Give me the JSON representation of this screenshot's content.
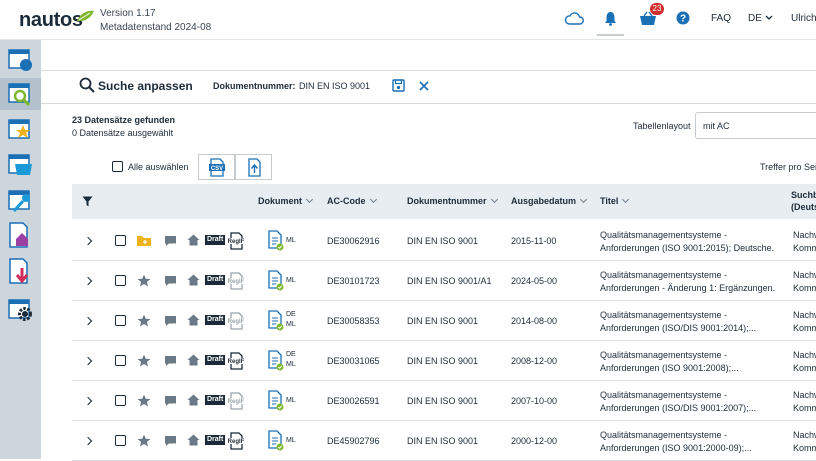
{
  "header": {
    "logo": "nautos",
    "version": "Version 1.17",
    "metadata": "Metadatenstand 2024-08",
    "basket_count": "23",
    "faq": "FAQ",
    "language": "DE",
    "user": "Ulrich"
  },
  "search": {
    "title": "Suche anpassen",
    "field_label": "Dokumentnummer:",
    "field_value": "DIN EN ISO 9001"
  },
  "results": {
    "found": "23 Datensätze gefunden",
    "selected": "0 Datensätze ausgewählt",
    "select_all": "Alle auswählen",
    "table_layout_label": "Tabellenlayout",
    "table_layout_value": "mit AC",
    "hits_per_page": "Treffer pro Seite"
  },
  "columns": {
    "document": "Dokument",
    "ac_code": "AC-Code",
    "doc_number": "Dokumentnummer",
    "issue_date": "Ausgabedatum",
    "title": "Titel",
    "search_line1": "Suchbe",
    "search_line2": "(Deuts"
  },
  "labels": {
    "draft": "Draft",
    "regif": "RegIF"
  },
  "rows": [
    {
      "lang1": "ML",
      "lang2": "",
      "ac": "DE30062916",
      "docnum": "DIN EN ISO 9001",
      "date": "2015-11-00",
      "title1": "Qualitätsmanagementsysteme -",
      "title2": "Anforderungen (ISO 9001:2015); Deutsche...",
      "n1": "Nachw",
      "n2": "Komm",
      "folder": true,
      "star": false,
      "regif_dark": true
    },
    {
      "lang1": "ML",
      "lang2": "",
      "ac": "DE30101723",
      "docnum": "DIN EN ISO 9001/A1",
      "date": "2024-05-00",
      "title1": "Qualitätsmanagementsysteme -",
      "title2": "Anforderungen - Änderung 1: Ergänzungen...",
      "n1": "Nachw",
      "n2": "Komm",
      "folder": false,
      "star": true,
      "regif_dark": false
    },
    {
      "lang1": "DE",
      "lang2": "ML",
      "ac": "DE30058353",
      "docnum": "DIN EN ISO 9001",
      "date": "2014-08-00",
      "title1": "Qualitätsmanagementsysteme -",
      "title2": "Anforderungen (ISO/DIS 9001:2014);...",
      "n1": "Nachw",
      "n2": "Komm",
      "folder": false,
      "star": true,
      "regif_dark": false
    },
    {
      "lang1": "DE",
      "lang2": "ML",
      "ac": "DE30031065",
      "docnum": "DIN EN ISO 9001",
      "date": "2008-12-00",
      "title1": "Qualitätsmanagementsysteme -",
      "title2": "Anforderungen (ISO 9001:2008);...",
      "n1": "Nachw",
      "n2": "Komm",
      "folder": false,
      "star": true,
      "regif_dark": true
    },
    {
      "lang1": "ML",
      "lang2": "",
      "ac": "DE30026591",
      "docnum": "DIN EN ISO 9001",
      "date": "2007-10-00",
      "title1": "Qualitätsmanagementsysteme -",
      "title2": "Anforderungen (ISO/DIS 9001:2007);...",
      "n1": "Nachw",
      "n2": "Komm",
      "folder": false,
      "star": true,
      "regif_dark": false
    },
    {
      "lang1": "ML",
      "lang2": "",
      "ac": "DE45902796",
      "docnum": "DIN EN ISO 9001",
      "date": "2000-12-00",
      "title1": "Qualitätsmanagementsysteme -",
      "title2": "Anforderungen (ISO 9001:2000-09);...",
      "n1": "Nachw",
      "n2": "Komm",
      "folder": false,
      "star": true,
      "regif_dark": true
    }
  ],
  "colors": {
    "accent": "#1a6fb5",
    "green": "#7fb82e",
    "nav": "#cdd5dd",
    "badge": "#d12d2d"
  }
}
